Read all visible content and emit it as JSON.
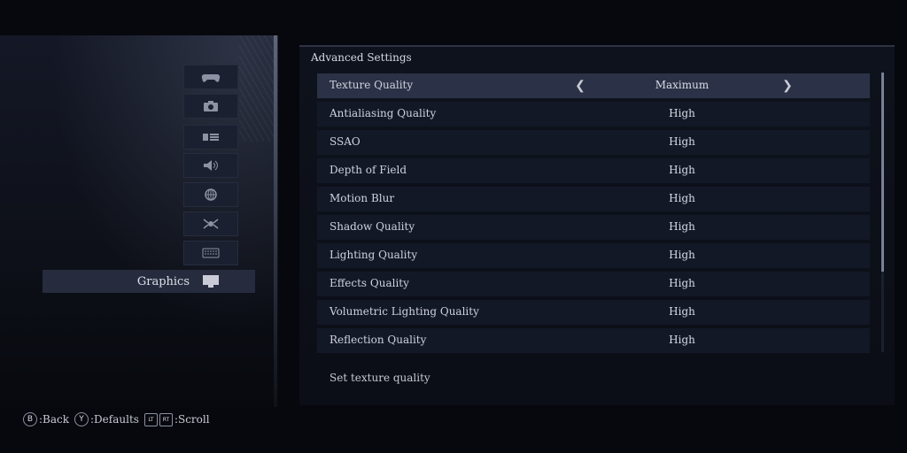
{
  "sidebar": {
    "icons": [
      "gamepad-icon",
      "camera-icon",
      "display-list-icon",
      "speaker-icon",
      "globe-icon",
      "network-icon",
      "keyboard-icon"
    ],
    "active_label": "Graphics",
    "active_icon": "monitor-icon"
  },
  "panel": {
    "title": "Advanced Settings",
    "rows": [
      {
        "name": "Texture Quality",
        "value": "Maximum",
        "selected": true
      },
      {
        "name": "Antialiasing Quality",
        "value": "High"
      },
      {
        "name": "SSAO",
        "value": "High"
      },
      {
        "name": "Depth of Field",
        "value": "High"
      },
      {
        "name": "Motion Blur",
        "value": "High"
      },
      {
        "name": "Shadow Quality",
        "value": "High"
      },
      {
        "name": "Lighting Quality",
        "value": "High"
      },
      {
        "name": "Effects Quality",
        "value": "High"
      },
      {
        "name": "Volumetric Lighting Quality",
        "value": "High"
      },
      {
        "name": "Reflection Quality",
        "value": "High"
      }
    ],
    "help_text": "Set texture quality"
  },
  "footer": {
    "back_glyph": "B",
    "back_label": ":Back",
    "defaults_glyph": "Y",
    "defaults_label": ":Defaults",
    "lt_glyph": "LT",
    "rt_glyph": "RT",
    "scroll_label": ":Scroll"
  }
}
